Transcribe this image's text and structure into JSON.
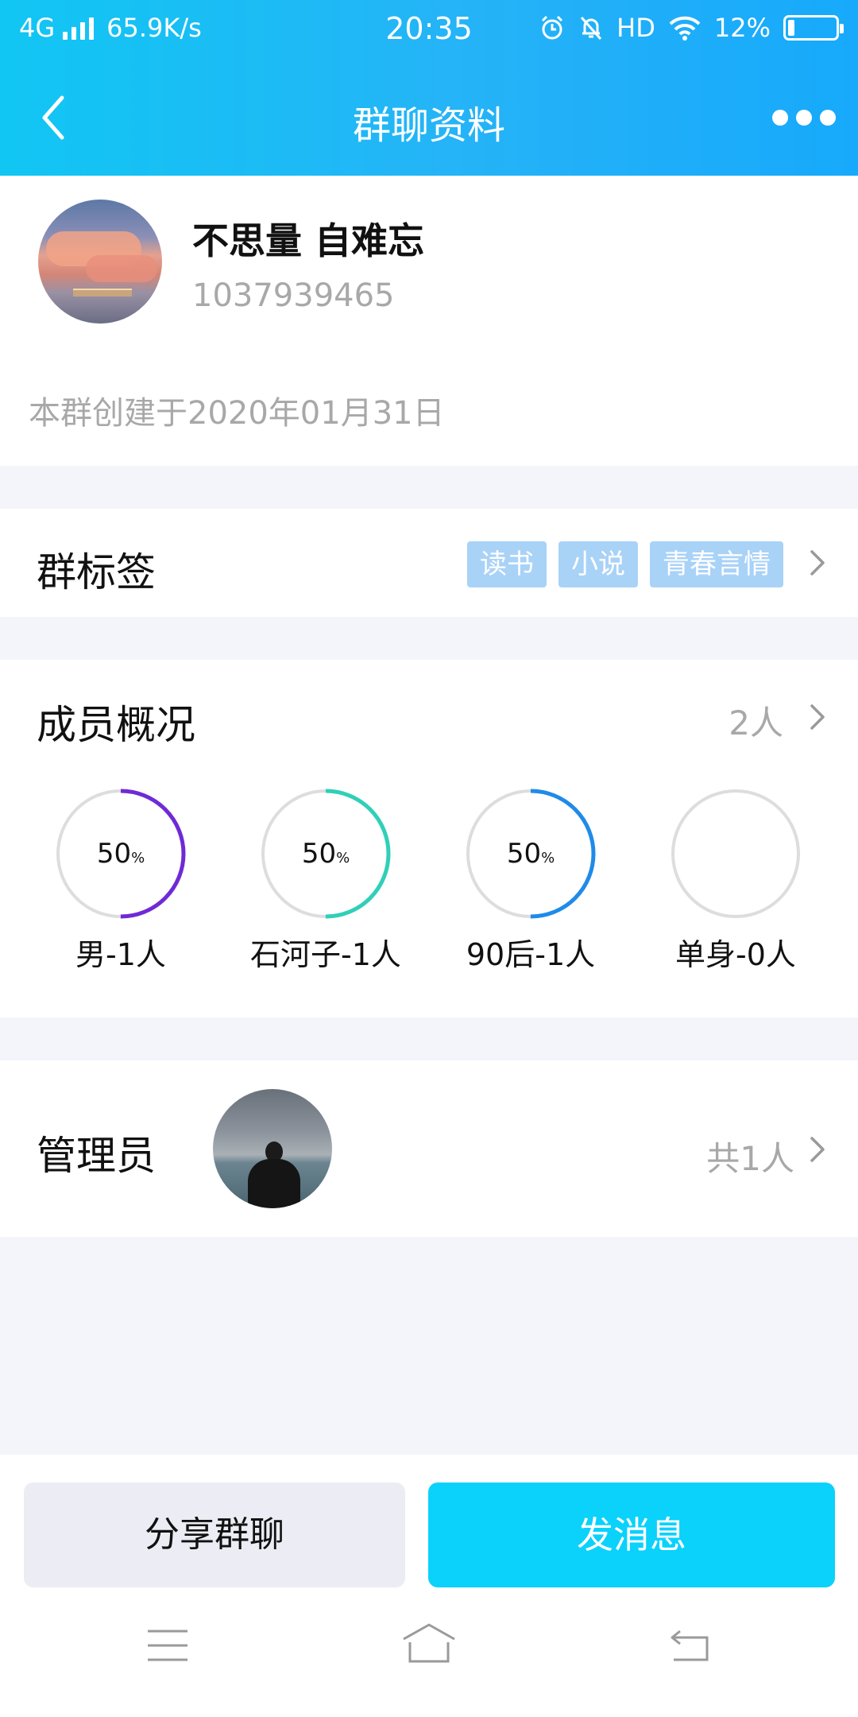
{
  "status_bar": {
    "network": "4G",
    "speed": "65.9K/s",
    "time": "20:35",
    "hd": "HD",
    "battery": "12%"
  },
  "nav": {
    "title": "群聊资料"
  },
  "group": {
    "name": "不思量 自难忘",
    "id": "1037939465",
    "created": "本群创建于2020年01月31日"
  },
  "tags_section": {
    "title": "群标签",
    "tags": [
      "读书",
      "小说",
      "青春言情"
    ]
  },
  "members_section": {
    "title": "成员概况",
    "count": "2人",
    "stats": [
      {
        "percent": "50",
        "unit": "%",
        "label": "男-1人",
        "value": 0.5,
        "color": "#6f2ad6"
      },
      {
        "percent": "50",
        "unit": "%",
        "label": "石河子-1人",
        "value": 0.5,
        "color": "#2fd0b7"
      },
      {
        "percent": "50",
        "unit": "%",
        "label": "90后-1人",
        "value": 0.5,
        "color": "#1f8be8"
      },
      {
        "percent": "",
        "unit": "",
        "label": "单身-0人",
        "value": 0,
        "color": "#dddddd"
      }
    ]
  },
  "admin_section": {
    "title": "管理员",
    "total": "共1人"
  },
  "buttons": {
    "share": "分享群聊",
    "send": "发消息"
  },
  "colors": {
    "header_start": "#11c6f3",
    "header_end": "#17a9fb",
    "tag_bg": "#a9d2f7",
    "send_button": "#0ad2fb"
  }
}
